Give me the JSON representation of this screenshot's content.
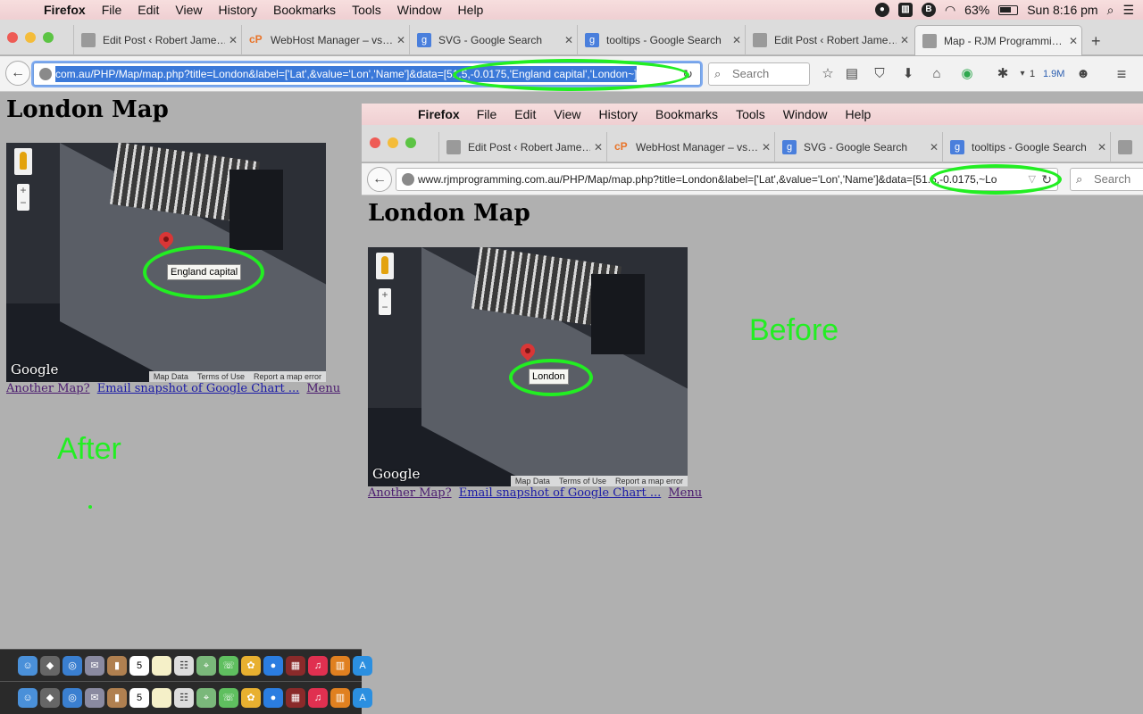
{
  "menubar": {
    "apple": "",
    "items": [
      "Firefox",
      "File",
      "Edit",
      "View",
      "History",
      "Bookmarks",
      "Tools",
      "Window",
      "Help"
    ],
    "battery": "63%",
    "clock": "Sun 8:16 pm"
  },
  "tabs": [
    {
      "label": "Edit Post ‹ Robert Jame…"
    },
    {
      "label": "WebHost Manager – vs…"
    },
    {
      "label": "SVG - Google Search"
    },
    {
      "label": "tooltips - Google Search"
    },
    {
      "label": "Edit Post ‹ Robert Jame…"
    },
    {
      "label": "Map - RJM Programmi…"
    }
  ],
  "navbar": {
    "url_prefix": "com.au/PHP/Map/map.php?title=London&label=['Lat',&value='Lon','Name']&data=",
    "url_selected": "[51.5,-0.0175,'England capital','London~]",
    "search_placeholder": "Search",
    "download_count": "1",
    "memory": "1.9M"
  },
  "after": {
    "title": "London Map",
    "tooltip": "England capital",
    "links": [
      "Another Map?",
      "Email snapshot of Google Chart ...",
      "Menu"
    ],
    "note": "After"
  },
  "map_attrib": [
    "Map Data",
    "Terms of Use",
    "Report a map error"
  ],
  "google_logo": "Google",
  "inner": {
    "menubar_items": [
      "Firefox",
      "File",
      "Edit",
      "View",
      "History",
      "Bookmarks",
      "Tools",
      "Window",
      "Help"
    ],
    "tabs": [
      {
        "label": "Edit Post ‹ Robert Jame…"
      },
      {
        "label": "WebHost Manager – vs…"
      },
      {
        "label": "SVG - Google Search"
      },
      {
        "label": "tooltips - Google Search"
      }
    ],
    "url_prefix": "www.rjmprogramming.com.au/PHP/Map/map.php?title=London&label=['Lat',&value='Lon','Name']&data=",
    "url_tail": "[51.5,-0.0175,~Lo",
    "search_placeholder": "Search",
    "title": "London Map",
    "tooltip": "London",
    "links": [
      "Another Map?",
      "Email snapshot of Google Chart ...",
      "Menu"
    ],
    "note": "Before"
  },
  "dock": {
    "calendar_day": "5"
  },
  "colors": {
    "highlight": "#22ee22",
    "page_bg": "#b0b0b0",
    "selection": "#3b79d9"
  }
}
